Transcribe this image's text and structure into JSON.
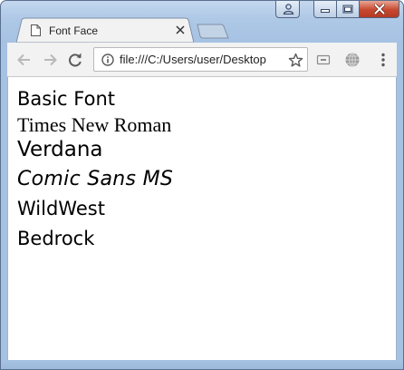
{
  "tab": {
    "title": "Font Face",
    "favicon": "document-icon",
    "close": "close-icon"
  },
  "toolbar": {
    "back": "back-arrow-icon",
    "forward": "forward-arrow-icon",
    "reload": "reload-icon",
    "address": "file:///C:/Users/user/Desktop",
    "site_info": "info-icon",
    "bookmark": "star-icon",
    "extensions": [
      "cast-icon",
      "globe-icon"
    ],
    "menu": "kebab-menu-icon"
  },
  "window_controls": [
    "user-icon",
    "minimize-icon",
    "maximize-icon",
    "close-icon"
  ],
  "content": {
    "lines": [
      "Basic Font",
      "Times New Roman",
      "Verdana",
      "Comic Sans MS",
      "WildWest",
      "Bedrock"
    ]
  },
  "colors": {
    "frame": "#a6c2e3",
    "toolbar": "#f2f2f2",
    "close_button": "#c7482f"
  }
}
